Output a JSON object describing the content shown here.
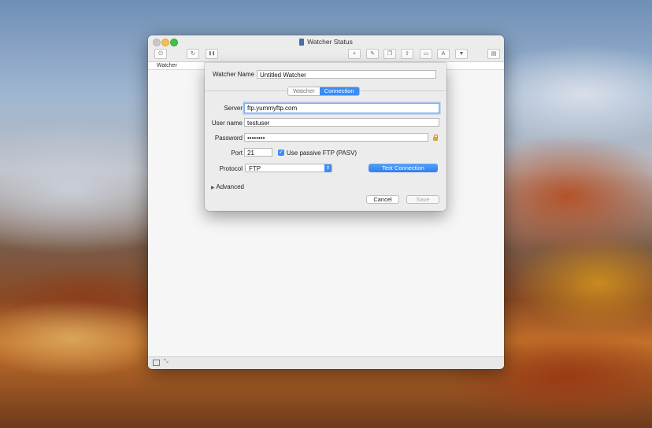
{
  "window": {
    "title": "Watcher Status"
  },
  "toolbar": {
    "buttons": [
      {
        "name": "power-icon",
        "glyph": "⏻"
      },
      {
        "name": "refresh-icon",
        "glyph": "↻"
      },
      {
        "name": "pause-icon",
        "glyph": "❚❚"
      },
      {
        "name": "new-document-icon",
        "glyph": "+"
      },
      {
        "name": "edit-document-icon",
        "glyph": "✎"
      },
      {
        "name": "copy-document-icon",
        "glyph": "❐"
      },
      {
        "name": "export-icon",
        "glyph": "⇪"
      },
      {
        "name": "folder-icon",
        "glyph": "▭"
      },
      {
        "name": "font-icon",
        "glyph": "A"
      },
      {
        "name": "filter-icon",
        "glyph": "▼"
      },
      {
        "name": "sidebar-icon",
        "glyph": "▤"
      }
    ]
  },
  "list": {
    "column_header": "Watcher"
  },
  "sheet": {
    "watcher_name_label": "Watcher Name",
    "watcher_name_value": "Untitled Watcher",
    "tabs": [
      "Watcher",
      "Connection"
    ],
    "selected_tab": "Connection",
    "server_label": "Server",
    "server_value": "ftp.yummyftp.com",
    "username_label": "User name",
    "username_value": "testuser",
    "password_label": "Password",
    "password_value": "••••••••",
    "port_label": "Port",
    "port_value": "21",
    "passive_label": "Use passive FTP (PASV)",
    "passive_checked": true,
    "protocol_label": "Protocol",
    "protocol_value": "FTP",
    "test_connection_label": "Test Connection",
    "advanced_label": "Advanced",
    "cancel_label": "Cancel",
    "save_label": "Save"
  },
  "colors": {
    "accent": "#3b8cf5",
    "window_bg": "#ececec"
  }
}
